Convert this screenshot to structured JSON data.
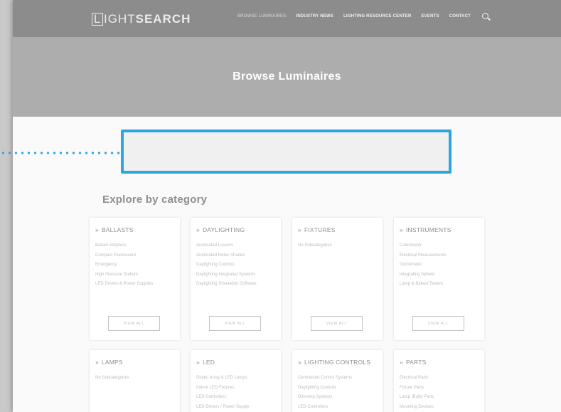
{
  "header": {
    "logo_first": "L",
    "logo_light": "IGHT",
    "logo_bold": "SEARCH",
    "nav": [
      {
        "label": "BROWSE LUMINAIRES"
      },
      {
        "label": "INDUSTRY NEWS"
      },
      {
        "label": "LIGHTING RESOURCE CENTER"
      },
      {
        "label": "EVENTS"
      },
      {
        "label": "CONTACT"
      }
    ],
    "search_icon": "search-icon"
  },
  "hero": {
    "title": "Browse Luminaires"
  },
  "section": {
    "title": "Explore by category"
  },
  "cards": [
    {
      "title": "BALLASTS",
      "items": [
        "Ballast Adapters",
        "Compact Fluorescent",
        "Emergency",
        "High Pressure Sodium",
        "LED Drivers & Power Supplies"
      ],
      "button": "VIEW ALL"
    },
    {
      "title": "DAYLIGHTING",
      "items": [
        "Automated Louvers",
        "Automated Roller Shades",
        "Daylighting Controls",
        "Daylighting Integrated Systems",
        "Daylighting Simulation Software"
      ],
      "button": "VIEW ALL"
    },
    {
      "title": "FIXTURES",
      "items": [
        "No Subcategories"
      ],
      "button": "VIEW ALL"
    },
    {
      "title": "INSTRUMENTS",
      "items": [
        "Colorimeter",
        "Electrical Measurements",
        "Goniometer",
        "Integrating Sphere",
        "Lamp & Ballast Testers"
      ],
      "button": "VIEW ALL"
    },
    {
      "title": "LAMPS",
      "items": [
        "No Subcategories"
      ]
    },
    {
      "title": "LED",
      "items": [
        "Diode, Array & LED Lamps",
        "Indoor LED Fixtures",
        "LED Controllers",
        "LED Drivers / Power Supply"
      ]
    },
    {
      "title": "LIGHTING CONTROLS",
      "items": [
        "Centralized Control Systems",
        "Daylighting Controls",
        "Dimming Systems",
        "LED Controllers"
      ]
    },
    {
      "title": "PARTS",
      "items": [
        "Electrical Parts",
        "Fixture Parts",
        "Lamp (Bulb) Parts",
        "Mounting Devices"
      ]
    }
  ],
  "colors": {
    "accent": "#2ba6e0",
    "header_bg": "#8c8c8c",
    "hero_bg": "#adadad"
  }
}
